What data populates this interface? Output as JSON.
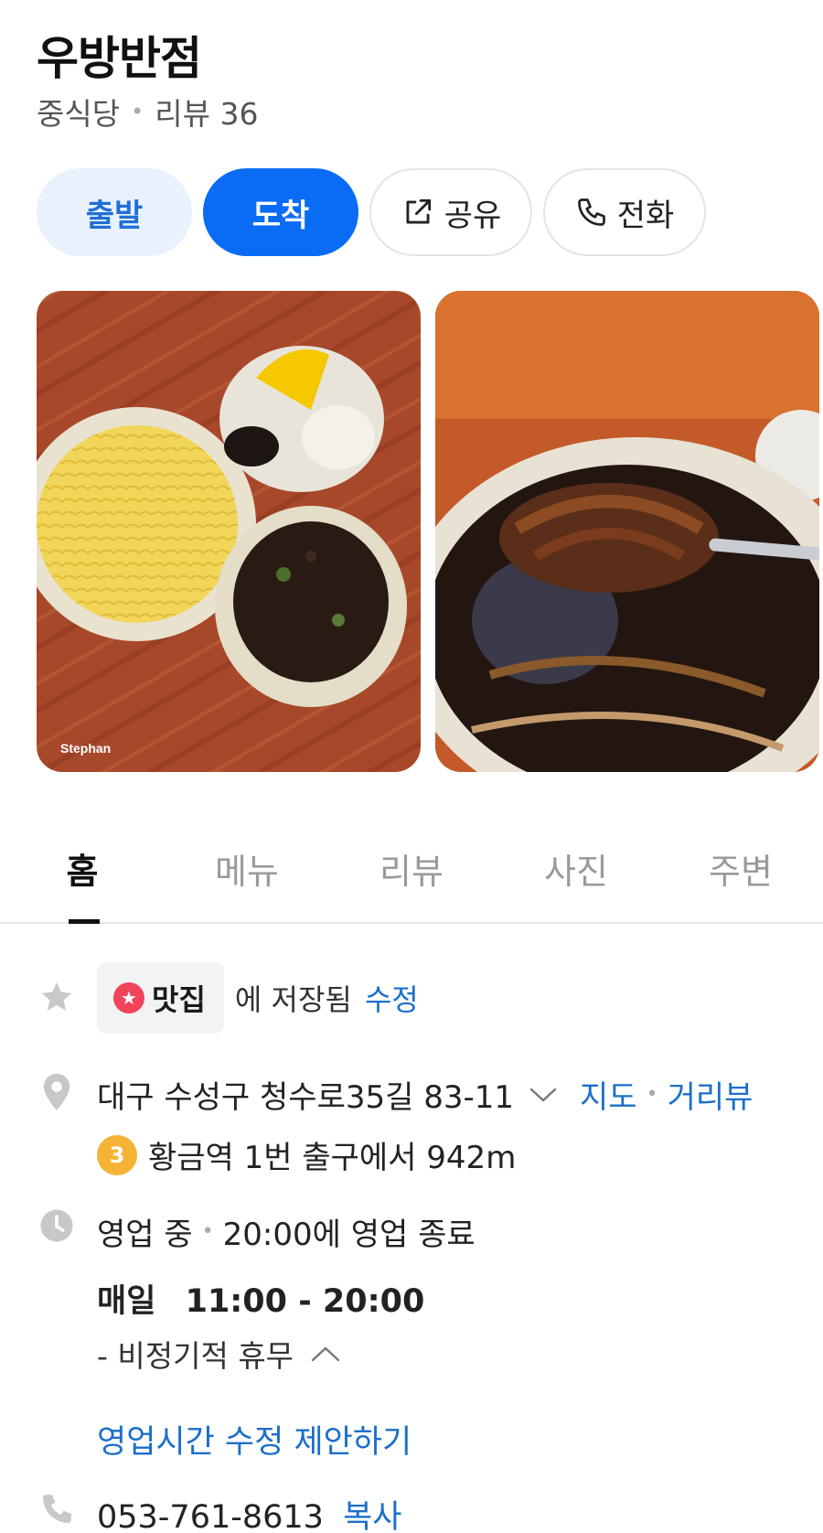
{
  "place": {
    "name": "우방반점",
    "category": "중식당",
    "review_label": "리뷰 36"
  },
  "actions": {
    "depart": "출발",
    "arrive": "도착",
    "share": "공유",
    "call": "전화"
  },
  "photos": {
    "credit": "Stephan"
  },
  "tabs": [
    "홈",
    "메뉴",
    "리뷰",
    "사진",
    "주변"
  ],
  "saved": {
    "list_name": "맛집",
    "text": "에 저장됨",
    "edit": "수정"
  },
  "address": {
    "text": "대구 수성구 청수로35길 83-11",
    "map_link": "지도",
    "street_view_link": "거리뷰",
    "station_line": "3",
    "station_text": "황금역 1번 출구에서 942m"
  },
  "hours": {
    "status": "영업 중",
    "closing": "20:00에 영업 종료",
    "days": "매일",
    "time": "11:00 - 20:00",
    "holiday": "- 비정기적 휴무",
    "suggest_edit": "영업시간 수정 제안하기"
  },
  "phone": {
    "number": "053-761-8613",
    "copy": "복사"
  },
  "colors": {
    "accent_blue": "#0a6cf5",
    "link_blue": "#1b6fc9",
    "saved_star": "#f0445a",
    "line3_badge": "#f5b335"
  }
}
